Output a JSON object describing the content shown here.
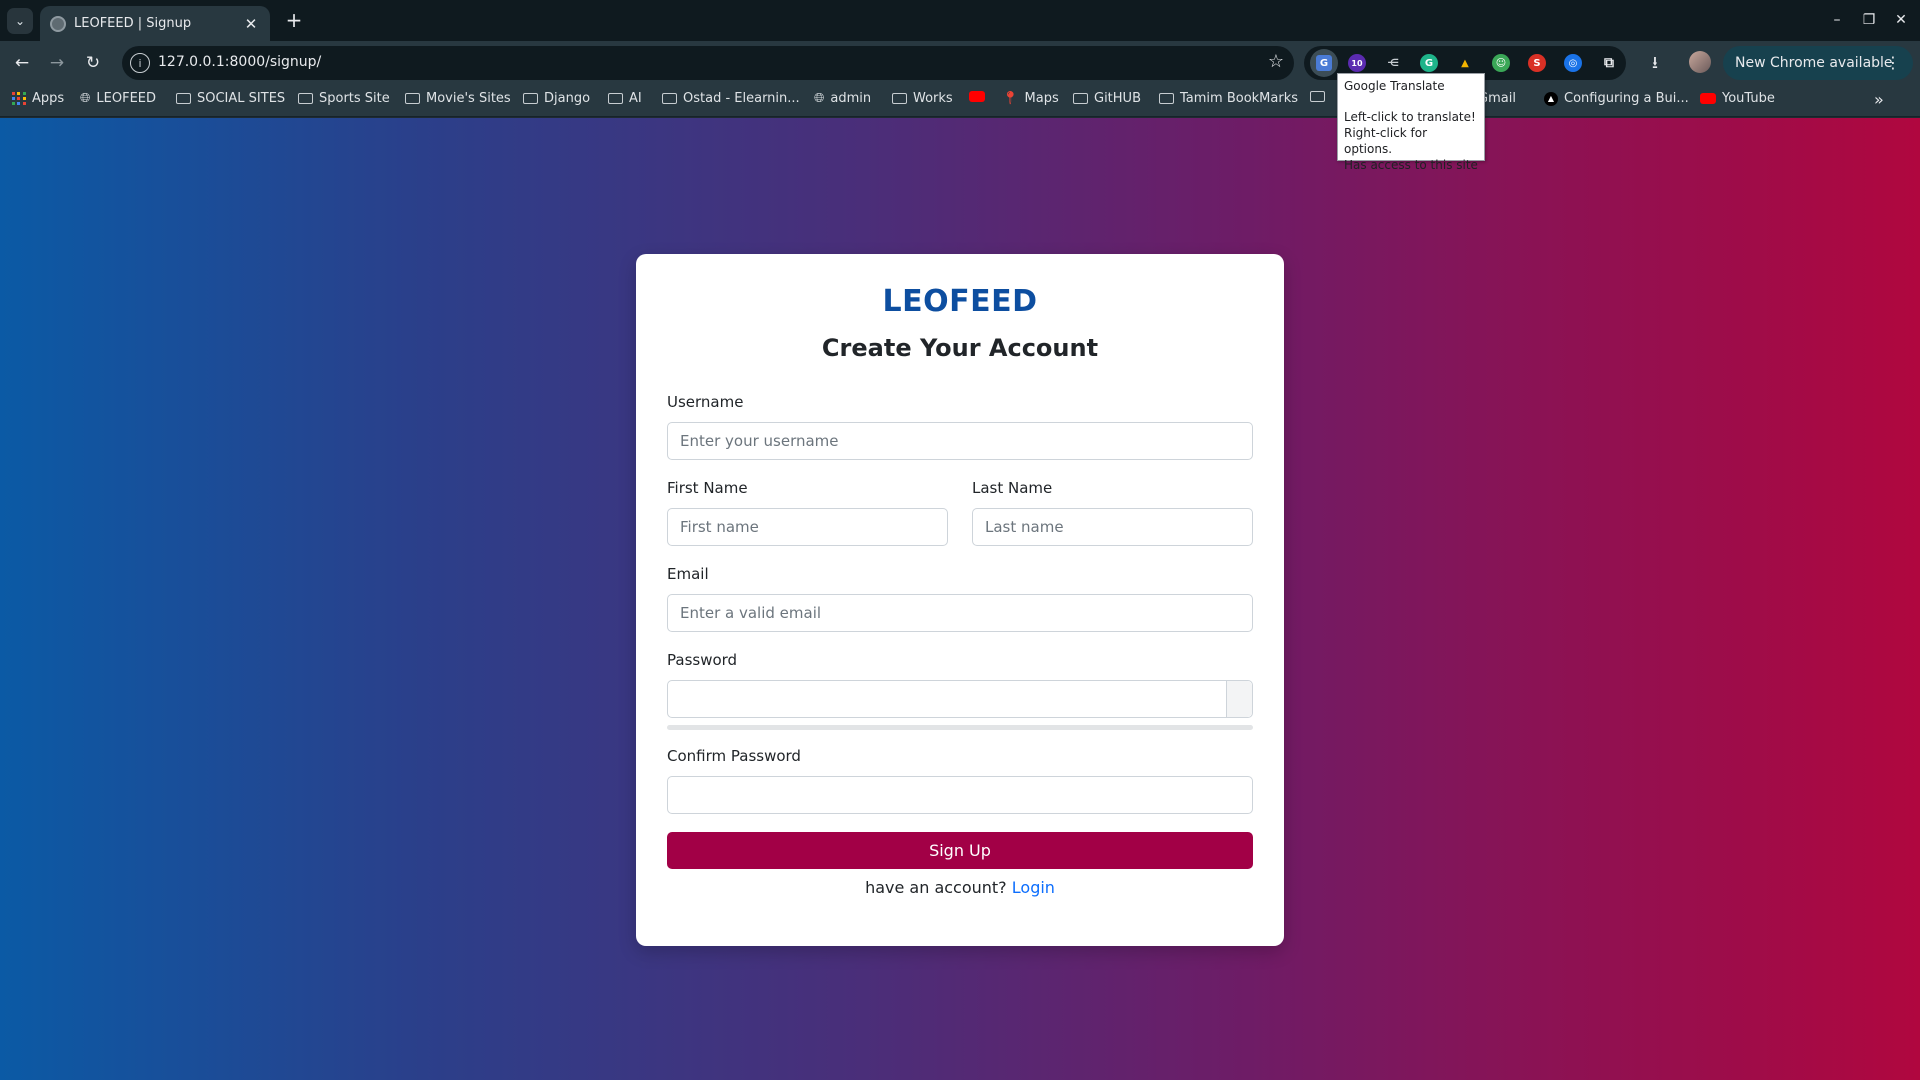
{
  "browser": {
    "tab": {
      "title": "LEOFEED | Signup"
    },
    "url": "127.0.0.1:8000/signup/",
    "update_label": "New Chrome available",
    "extension_badge": "10",
    "bookmarks": [
      {
        "label": "Apps",
        "icon": "apps-grid-icon"
      },
      {
        "label": "LEOFEED",
        "icon": "globe-icon"
      },
      {
        "label": "SOCIAL SITES",
        "icon": "folder-icon"
      },
      {
        "label": "Sports Site",
        "icon": "folder-icon"
      },
      {
        "label": "Movie's Sites",
        "icon": "folder-icon"
      },
      {
        "label": "Django",
        "icon": "folder-icon"
      },
      {
        "label": "AI",
        "icon": "folder-icon"
      },
      {
        "label": "Ostad - Elearnin...",
        "icon": "folder-icon"
      },
      {
        "label": "admin",
        "icon": "globe-icon"
      },
      {
        "label": "Works",
        "icon": "folder-icon"
      },
      {
        "label": "",
        "icon": "youtube-icon"
      },
      {
        "label": "Maps",
        "icon": "maps-pin-icon"
      },
      {
        "label": "GitHUB",
        "icon": "folder-icon"
      },
      {
        "label": "Tamim BookMarks",
        "icon": "folder-icon"
      },
      {
        "label": "Gmail",
        "icon": "gmail-icon"
      },
      {
        "label": "Configuring a Bui...",
        "icon": "triangle-icon"
      },
      {
        "label": "YouTube",
        "icon": "youtube-icon"
      }
    ],
    "tooltip": {
      "title": "Google Translate",
      "line1": "Left-click to translate!",
      "line2": "Right-click for options.",
      "line3": "Has access to this site"
    }
  },
  "form": {
    "brand": "LEOFEED",
    "heading": "Create Your Account",
    "username": {
      "label": "Username",
      "placeholder": "Enter your username"
    },
    "first_name": {
      "label": "First Name",
      "placeholder": "First name"
    },
    "last_name": {
      "label": "Last Name",
      "placeholder": "Last name"
    },
    "email": {
      "label": "Email",
      "placeholder": "Enter a valid email"
    },
    "password": {
      "label": "Password"
    },
    "confirm_password": {
      "label": "Confirm Password"
    },
    "submit_label": "Sign Up",
    "login_prompt": "have an account?",
    "login_link": "Login"
  },
  "colors": {
    "brand": "#0d4ea0",
    "button": "#a20046",
    "link": "#0d6efd",
    "gradient_start": "#0b5aa5",
    "gradient_end": "#b0073f"
  }
}
